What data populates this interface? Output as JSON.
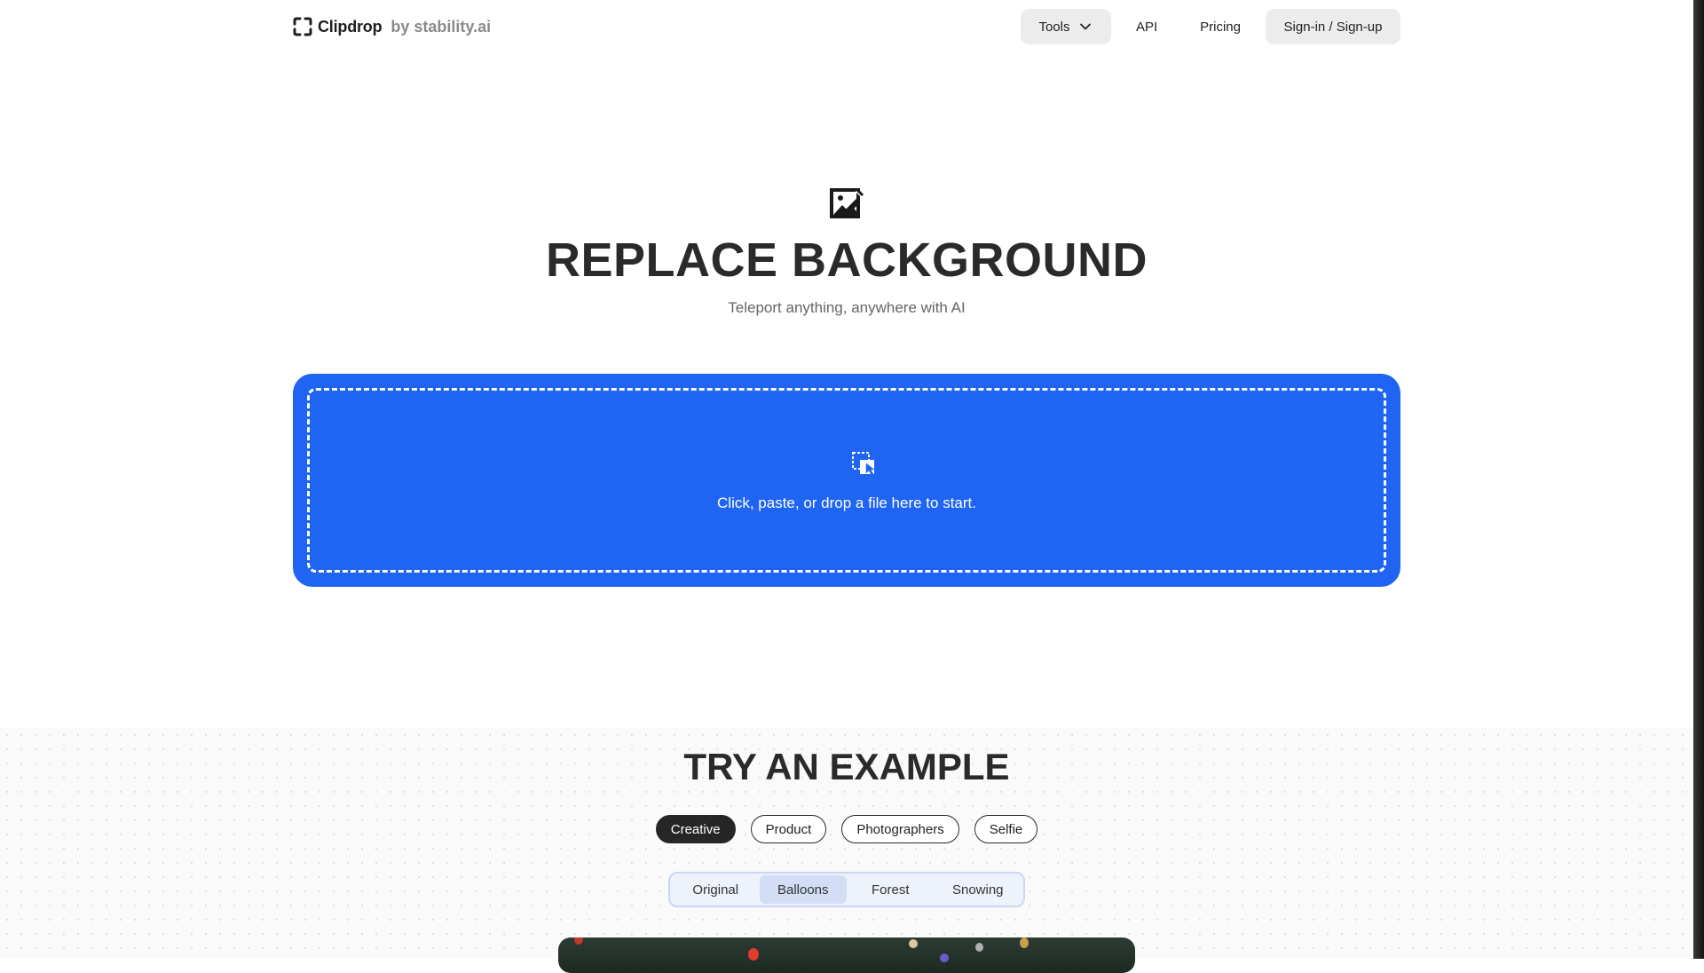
{
  "brand": {
    "name": "Clipdrop",
    "by": "by stability.ai"
  },
  "nav": {
    "tools_label": "Tools",
    "api_label": "API",
    "pricing_label": "Pricing",
    "signin_label": "Sign-in / Sign-up"
  },
  "hero": {
    "icon": "image-edit-icon",
    "title": "REPLACE BACKGROUND",
    "subtitle": "Teleport anything, anywhere with AI"
  },
  "dropzone": {
    "icon": "drop-file-icon",
    "text": "Click, paste, or drop a file here to start.",
    "color": "#1f64f2"
  },
  "examples": {
    "title": "TRY AN EXAMPLE",
    "categories": [
      "Creative",
      "Product",
      "Photographers",
      "Selfie"
    ],
    "active_category": "Creative",
    "variants": [
      "Original",
      "Balloons",
      "Forest",
      "Snowing"
    ],
    "active_variant": "Balloons"
  }
}
